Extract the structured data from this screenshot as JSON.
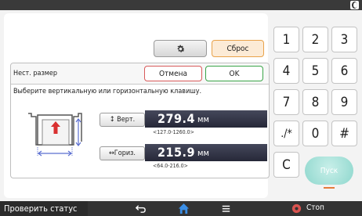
{
  "toolbar": {
    "reset_label": "Сброс"
  },
  "panel": {
    "title": "Нест. размер",
    "cancel_label": "Отмена",
    "ok_label": "OK",
    "instruction": "Выберите вертикальную или горизонтальную клавишу."
  },
  "vertical": {
    "label": "↕ Верт.",
    "value": "279.4",
    "unit": "мм",
    "range": "<127.0-1260.0>"
  },
  "horizontal": {
    "label": "↔Гориз.",
    "value": "215.9",
    "unit": "мм",
    "range": "<64.0-216.0>"
  },
  "keypad": {
    "keys": [
      "1",
      "2",
      "3",
      "4",
      "5",
      "6",
      "7",
      "8",
      "9",
      "./*",
      "0",
      "#",
      "C"
    ],
    "start_label": "Пуск"
  },
  "bottom_bar": {
    "status_label": "Проверить статус",
    "stop_label": "Стоп"
  },
  "icons": [
    "gear-icon",
    "moon-icon",
    "back-icon",
    "home-icon",
    "menu-icon",
    "stop-icon"
  ],
  "colors": {
    "ok_accent": "#3aa448",
    "cancel_accent": "#d85a5a",
    "start_green": "#8ed7cd",
    "home_blue": "#3a8ee6",
    "stop_red": "#d9534f"
  }
}
